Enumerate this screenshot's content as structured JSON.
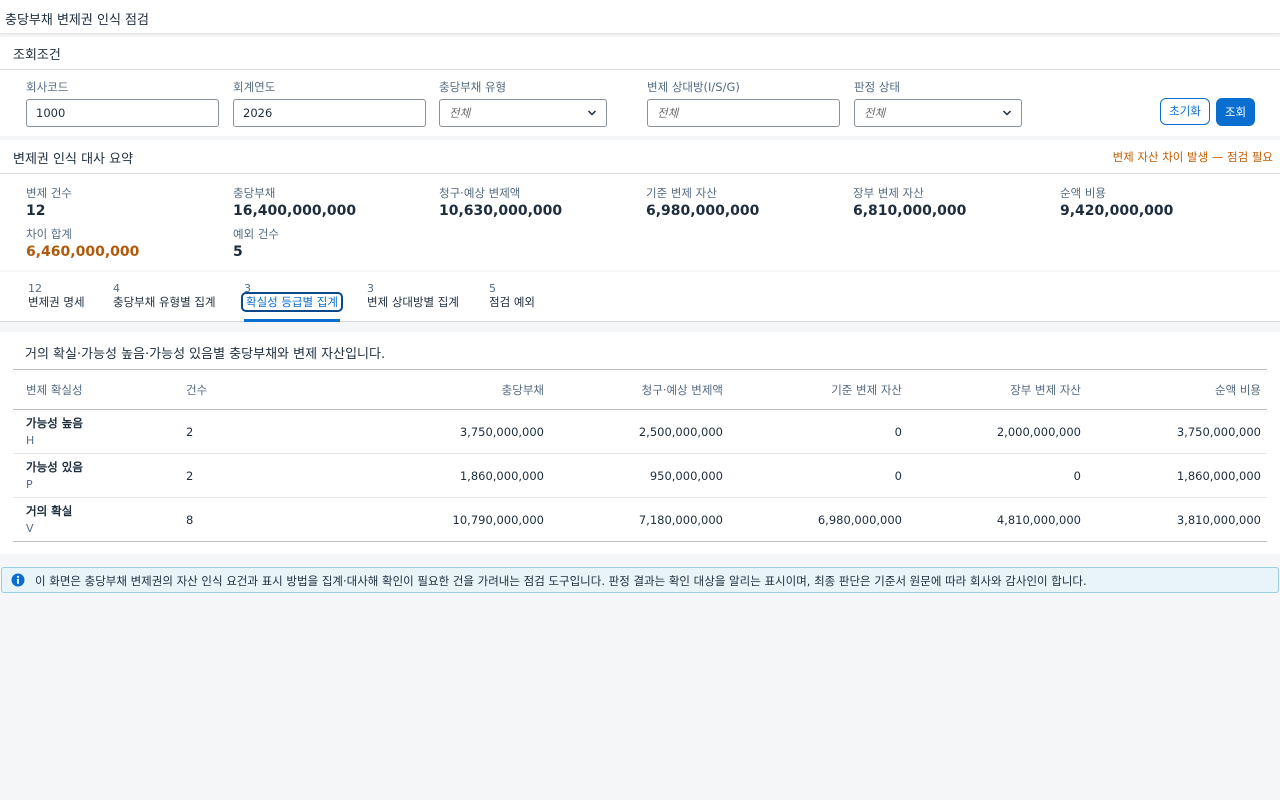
{
  "app": {
    "title": "충당부채 변제권 인식 점검"
  },
  "filter": {
    "title": "조회조건",
    "company_label": "회사코드",
    "company_value": "1000",
    "year_label": "회계연도",
    "year_value": "2026",
    "type_label": "충당부채 유형",
    "type_value": "전체",
    "counterparty_label": "변제 상대방(I/S/G)",
    "counterparty_placeholder": "전체",
    "status_label": "판정 상태",
    "status_value": "전체",
    "reset_label": "초기화",
    "search_label": "조회"
  },
  "summary": {
    "title": "변제권 인식 대사 요약",
    "warning": "변제 자산 차이 발생 — 점검 필요",
    "kpis": [
      {
        "label": "변제 건수",
        "value": "12"
      },
      {
        "label": "충당부채",
        "value": "16,400,000,000"
      },
      {
        "label": "청구·예상 변제액",
        "value": "10,630,000,000"
      },
      {
        "label": "기준 변제 자산",
        "value": "6,980,000,000"
      },
      {
        "label": "장부 변제 자산",
        "value": "6,810,000,000"
      },
      {
        "label": "순액 비용",
        "value": "9,420,000,000"
      },
      {
        "label": "차이 합계",
        "value": "6,460,000,000"
      },
      {
        "label": "예외 건수",
        "value": "5"
      }
    ],
    "warn_color": "#b05a0c"
  },
  "tabs": [
    {
      "count": "12",
      "label": "변제권 명세"
    },
    {
      "count": "4",
      "label": "충당부채 유형별 집계"
    },
    {
      "count": "3",
      "label": "확실성 등급별 집계"
    },
    {
      "count": "3",
      "label": "변제 상대방별 집계"
    },
    {
      "count": "5",
      "label": "점검 예외"
    }
  ],
  "table": {
    "description": "거의 확실·가능성 높음·가능성 있음별 충당부채와 변제 자산입니다.",
    "headers": [
      "변제 확실성",
      "건수",
      "충당부채",
      "청구·예상 변제액",
      "기준 변제 자산",
      "장부 변제 자산",
      "순액 비용"
    ],
    "rows": [
      {
        "name": "가능성 높음",
        "code": "H",
        "count": "2",
        "provision": "3,750,000,000",
        "claim": "2,500,000,000",
        "base": "0",
        "book": "2,000,000,000",
        "net": "3,750,000,000"
      },
      {
        "name": "가능성 있음",
        "code": "P",
        "count": "2",
        "provision": "1,860,000,000",
        "claim": "950,000,000",
        "base": "0",
        "book": "0",
        "net": "1,860,000,000"
      },
      {
        "name": "거의 확실",
        "code": "V",
        "count": "8",
        "provision": "10,790,000,000",
        "claim": "7,180,000,000",
        "base": "6,980,000,000",
        "book": "4,810,000,000",
        "net": "3,810,000,000"
      }
    ]
  },
  "info": {
    "message": "이 화면은 충당부채 변제권의 자산 인식 요건과 표시 방법을 집계·대사해 확인이 필요한 건을 가려내는 점검 도구입니다. 판정 결과는 확인 대상을 알리는 표시이며, 최종 판단은 기준서 원문에 따라 회사와 감사인이 합니다.",
    "icon": "info-icon"
  },
  "colors": {
    "accent": "#0a6ed1",
    "warning": "#c45e07"
  }
}
